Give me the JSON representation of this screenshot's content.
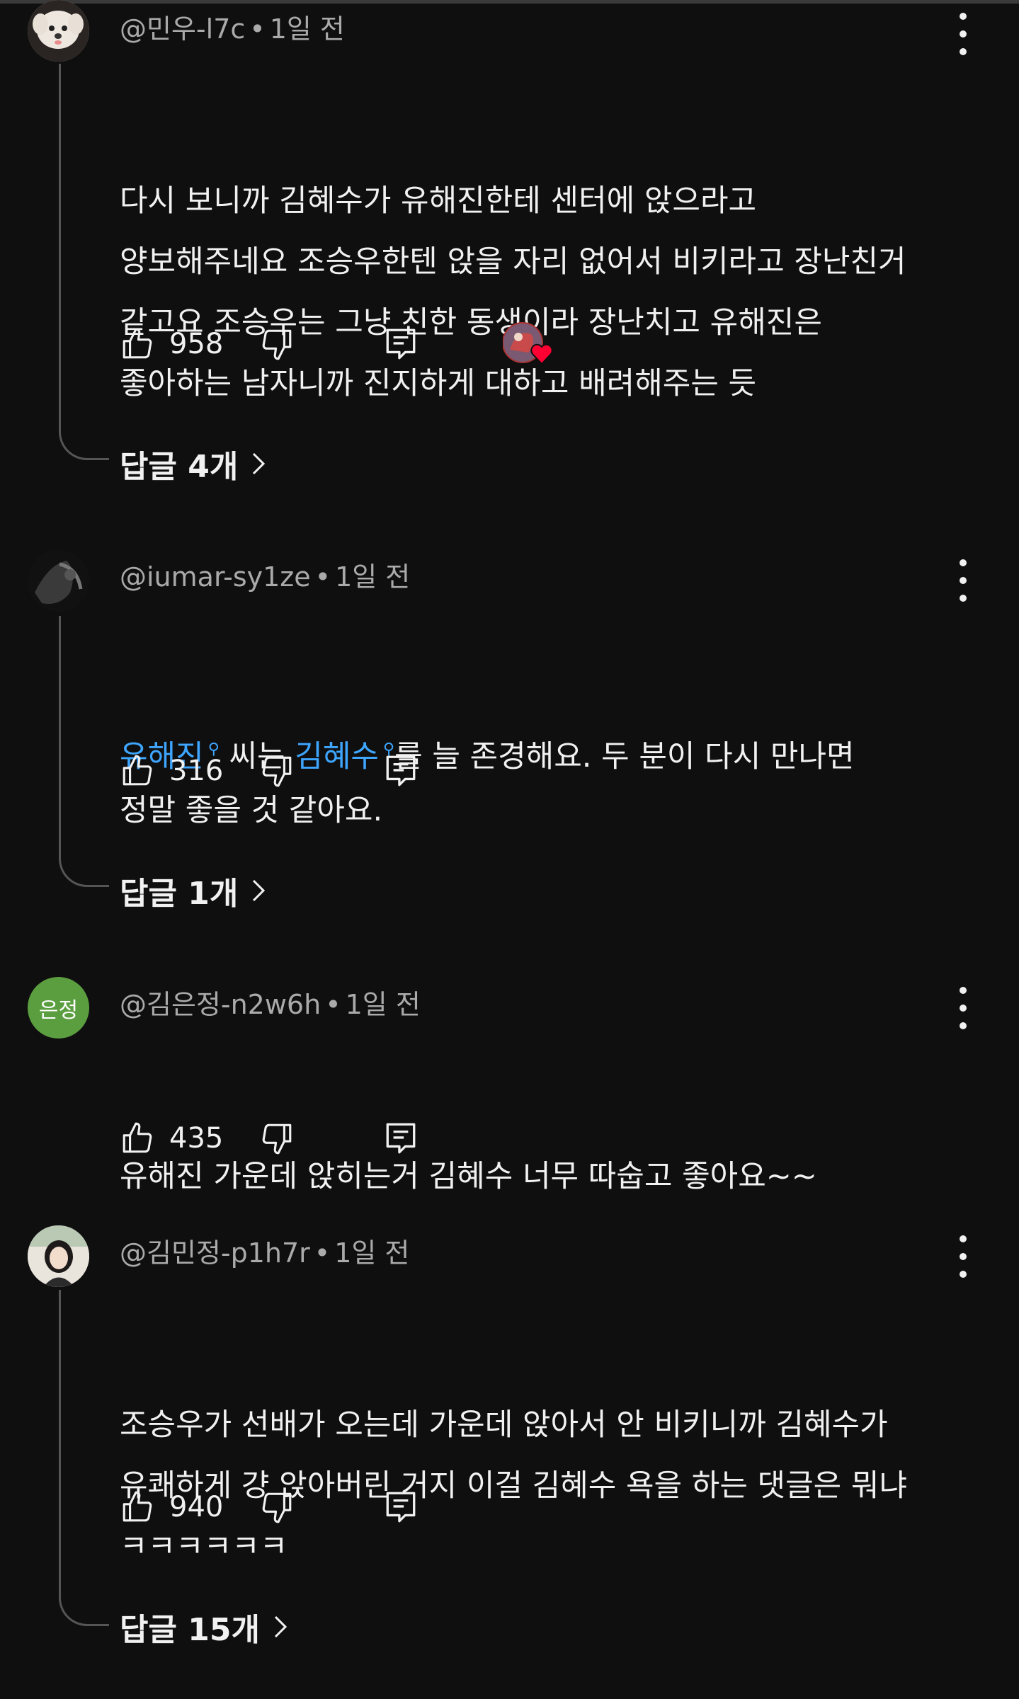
{
  "comments": [
    {
      "author": "@민우-l7c",
      "time": "1일 전",
      "lines": [
        "다시 보니까 김혜수가 유해진한테 센터에 앉으라고",
        "양보해주네요 조승우한텐 앉을 자리 없어서 비키라고 장난친거",
        "같고요 조승우는 그냥 친한 동생이라 장난치고 유해진은",
        "좋아하는 남자니까 진지하게 대하고 배려해주는 듯"
      ],
      "likes": "958",
      "replies": "답글 4개",
      "creator_heart": true
    },
    {
      "author": "@iumar-sy1ze",
      "time": "1일 전",
      "line1": {
        "tag1": "유해진",
        "text1": " 씨는 ",
        "tag2": "김혜수",
        "text2": "를 늘 존경해요. 두 분이 다시 만나면"
      },
      "line2": "정말 좋을 것 같아요.",
      "likes": "316",
      "replies": "답글 1개"
    },
    {
      "author": "@김은정-n2w6h",
      "time": "1일 전",
      "avatar_text": "은정",
      "avatar_color": "#5b9e3f",
      "lines": [
        "유해진 가운데 앉히는거 김혜수 너무 따숩고 좋아요~~"
      ],
      "likes": "435"
    },
    {
      "author": "@김민정-p1h7r",
      "time": "1일 전",
      "lines": [
        "조승우가 선배가 오는데 가운데 앉아서 안 비키니까 김혜수가",
        "유쾌하게 걍 앉아버린 거지 이걸 김혜수 욕을 하는 댓글은 뭐냐",
        "ㅋㅋㅋㅋㅋㅋ"
      ],
      "likes": "940",
      "replies": "답글 15개"
    }
  ],
  "separator": "•",
  "icons": {
    "like": "thumbs-up-icon",
    "dislike": "thumbs-down-icon",
    "reply": "reply-comment-icon",
    "more": "more-vert-icon",
    "chevron": "chevron-right-icon",
    "heart": "heart-icon"
  },
  "colors": {
    "background": "#0f0f0f",
    "link": "#3ea6ff",
    "heart": "#ff0033"
  }
}
